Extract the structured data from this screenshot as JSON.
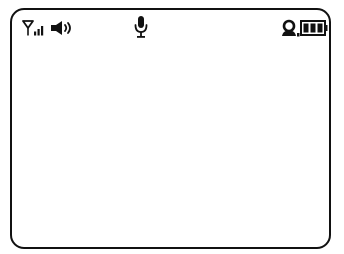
{
  "status_bar": {
    "left_icons": [
      "signal-strength-icon",
      "speaker-volume-icon"
    ],
    "center_icons": [
      "microphone-icon"
    ],
    "right_icons": [
      "user-profile-icon",
      "battery-icon"
    ],
    "battery_level": 1.0,
    "signal_level": 1.0
  },
  "colors": {
    "foreground": "#111111",
    "background": "#ffffff"
  }
}
